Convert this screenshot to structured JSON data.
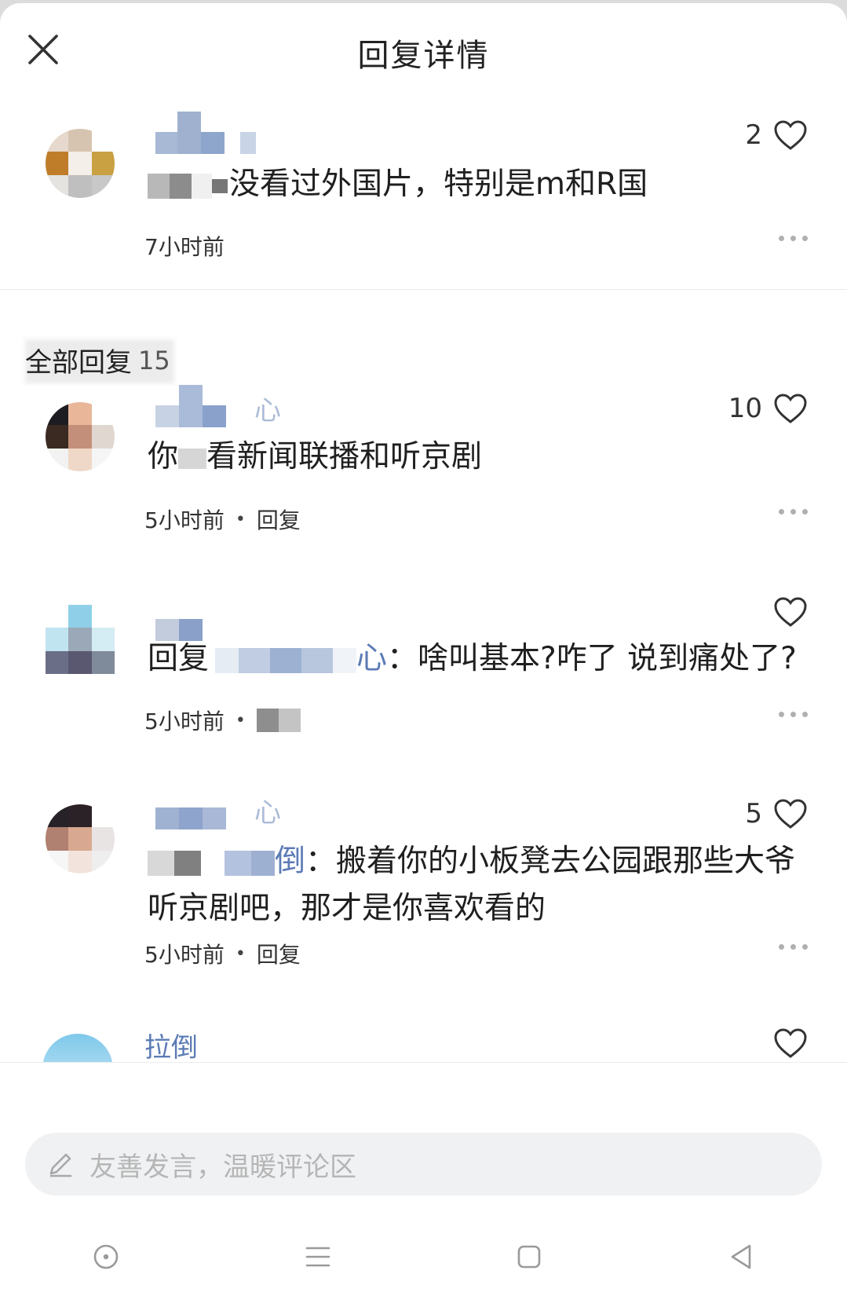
{
  "header": {
    "title": "回复详情"
  },
  "root_comment": {
    "likes": "2",
    "text_partial": "没看过外国片，特别是m和R国",
    "time": "7小时前"
  },
  "section": {
    "title": "全部回复",
    "count": "15"
  },
  "replies": [
    {
      "name_suffix": "心",
      "likes": "10",
      "text_start": "你",
      "text_mid": "看新闻联播和听京剧",
      "time": "5小时前",
      "reply_label": "回复"
    },
    {
      "likes": "",
      "reply_prefix": "回复",
      "mention_suffix": "心",
      "text": "：啥叫基本?咋了 说到痛处了?",
      "time": "5小时前"
    },
    {
      "name_suffix": "心",
      "likes": "5",
      "mention_suffix": "倒",
      "text_line1": "：搬着你的小板凳去公园跟那些大爷",
      "text_line2": "听京剧吧，那才是你喜欢看的",
      "time": "5小时前",
      "reply_label": "回复"
    },
    {
      "name": "拉倒",
      "likes": ""
    }
  ],
  "input": {
    "placeholder": "友善发言，温暖评论区"
  },
  "icons": {
    "close": "close-icon",
    "heart": "heart-icon",
    "more": "more-dots-icon",
    "pen": "pen-icon",
    "nav": [
      "home-circle-icon",
      "menu-lines-icon",
      "square-recents-icon",
      "back-triangle-icon"
    ]
  },
  "colors": {
    "mention": "#5b7bb5",
    "background": "#ffffff",
    "input_bg": "#f0f1f3"
  }
}
